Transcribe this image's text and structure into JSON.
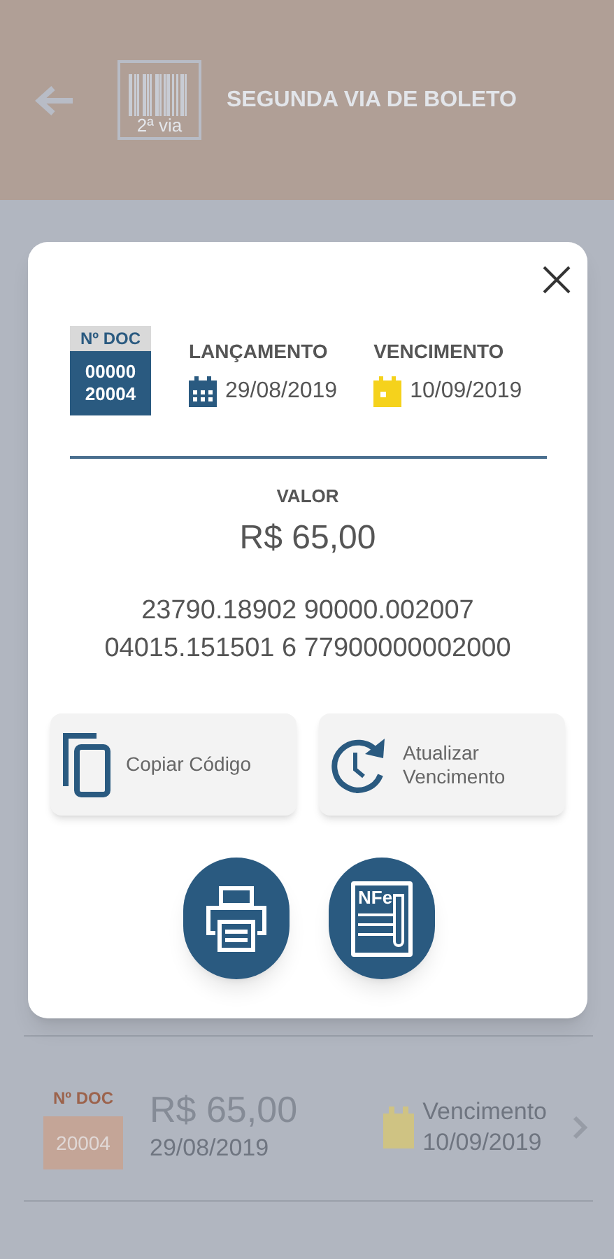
{
  "header": {
    "title": "SEGUNDA VIA DE BOLETO",
    "logo_text": "2ª via"
  },
  "modal": {
    "doc_label": "Nº DOC",
    "doc_number": [
      "00000",
      "20004"
    ],
    "dates": [
      {
        "label": "LANÇAMENTO",
        "value": "29/08/2019",
        "color": "#2a5a80"
      },
      {
        "label": "VENCIMENTO",
        "value": "10/09/2019",
        "color": "#f5d21c"
      }
    ],
    "value_label": "VALOR",
    "value": "R$ 65,00",
    "barcode_lines": [
      "23790.18902 90000.002007",
      "04015.151501 6 77900000002000"
    ],
    "actions": [
      {
        "kind": "copy",
        "label": "Copiar Código"
      },
      {
        "kind": "refresh",
        "label": "Atualizar Vencimento"
      }
    ],
    "round_buttons": [
      {
        "kind": "print"
      },
      {
        "kind": "invoice",
        "label": "NFe"
      }
    ]
  },
  "list": [
    {
      "doc_label": "Nº DOC",
      "doc_number": "20004",
      "value": "R$ 65,00",
      "date": "29/08/2019",
      "due_label": "Vencimento",
      "due_date": "10/09/2019"
    }
  ]
}
